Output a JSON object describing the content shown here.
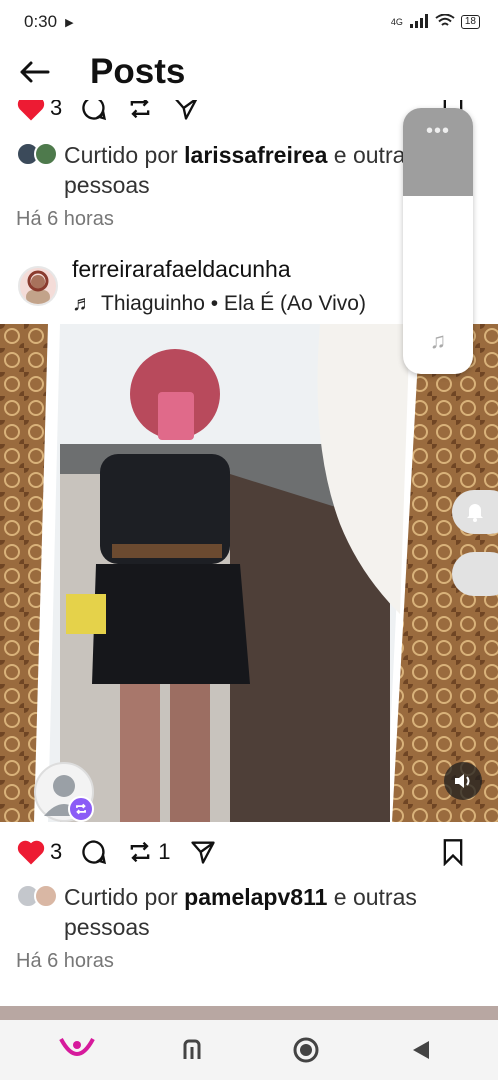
{
  "status": {
    "time": "0:30",
    "network": "4G",
    "battery": "18"
  },
  "header": {
    "title": "Posts"
  },
  "prev_post": {
    "likes": "3",
    "liked_by_prefix": "Curtido por",
    "liked_by_user": "larissafreirea",
    "liked_by_suffix": "e outras pessoas",
    "time": "Há 6 horas"
  },
  "post": {
    "username": "ferreirarafaeldacunha",
    "music": "Thiaguinho • Ela É (Ao Vivo)",
    "likes": "3",
    "reposts": "1",
    "liked_by_prefix": "Curtido por",
    "liked_by_user": "pamelapv811",
    "liked_by_suffix": "e outras pessoas",
    "time": "Há 6 horas"
  },
  "icons": {
    "back": "arrow-left-icon",
    "like": "heart-icon",
    "comment": "comment-icon",
    "repost": "repost-icon",
    "share": "send-icon",
    "save": "bookmark-icon",
    "music": "music-note-icon",
    "mute": "speaker-icon"
  },
  "colors": {
    "like_red": "#ed1b33",
    "accent_purple": "#8b5cf6"
  }
}
